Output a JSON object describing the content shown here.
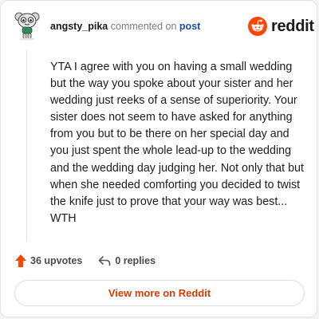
{
  "comment": {
    "username": "angsty_pika",
    "action_text": "commented on",
    "post_link_text": "post",
    "body": "YTA I agree with you on having a small wedding but the way you spoke about your sister and her wedding just reeks of a sense of superiority. Your sister does not seem to have asked for anything from you but to be there on her special day and you just spent the whole lead-up to the wedding and the wedding day judging her. Not only that but when she needed comforting you decided to twist the knife just to prove that your way was best... WTH"
  },
  "brand": {
    "name": "reddit",
    "icon": "reddit-snoo-icon",
    "color": "#ff4500"
  },
  "stats": {
    "upvotes_label": "36 upvotes",
    "replies_label": "0 replies",
    "upvote_icon": "upvote-arrow-icon",
    "upvote_color": "#ff4500",
    "reply_icon": "reply-arrow-icon"
  },
  "footer": {
    "button_label": "View more on Reddit",
    "button_color": "#d93a00"
  }
}
